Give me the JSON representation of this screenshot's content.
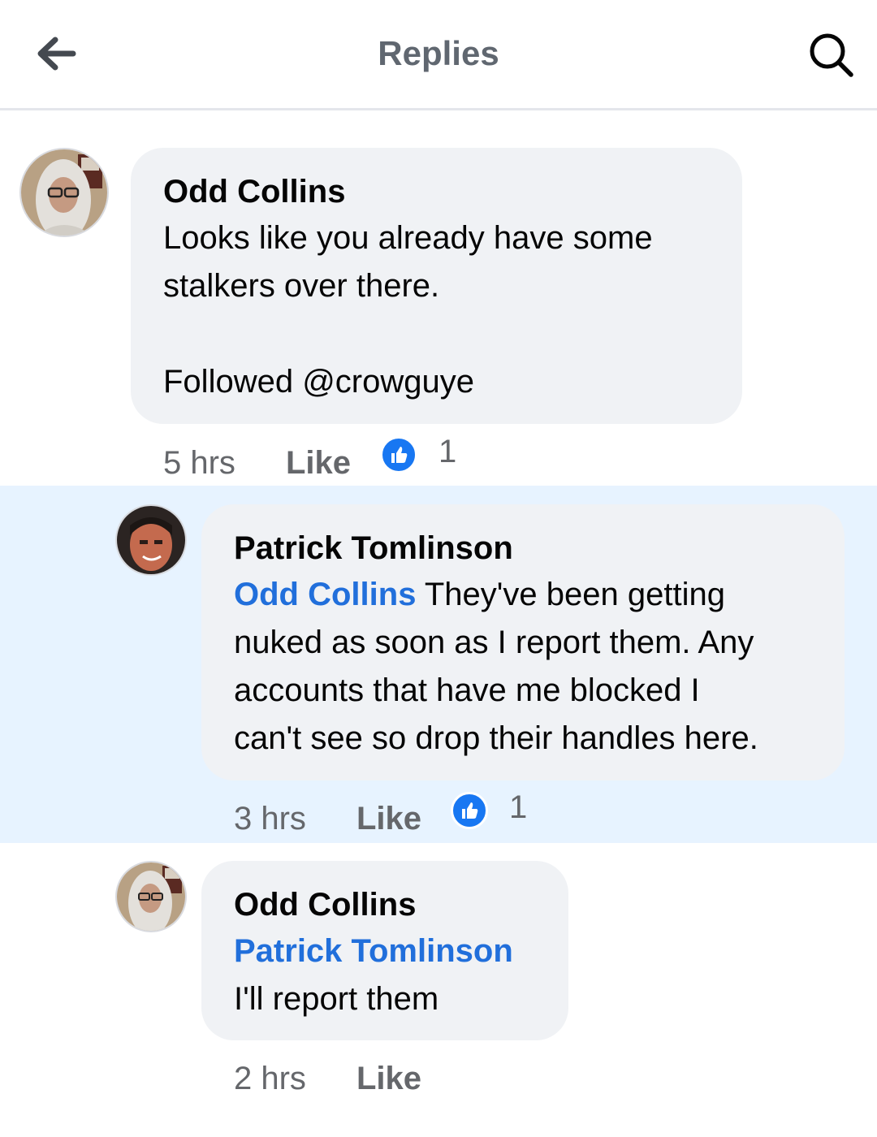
{
  "header": {
    "title": "Replies",
    "back_icon": "arrow-left-icon",
    "search_icon": "search-icon"
  },
  "comments": [
    {
      "author": "Odd Collins",
      "mention": "",
      "text": "Looks like you already have some\nstalkers over there.\n\nFollowed @crowguye",
      "time": "5 hrs",
      "like_label": "Like",
      "reaction_count": "1",
      "highlighted": false
    },
    {
      "author": "Patrick Tomlinson",
      "mention": "Odd Collins",
      "text": " They've been getting\nnuked as soon as I report them. Any\naccounts that have me blocked I\ncan't see so drop their handles here.",
      "time": "3 hrs",
      "like_label": "Like",
      "reaction_count": "1",
      "highlighted": true
    },
    {
      "author": "Odd Collins",
      "mention": "Patrick Tomlinson",
      "text": "I'll report them",
      "time": "2 hrs",
      "like_label": "Like",
      "reaction_count": "",
      "highlighted": false
    }
  ],
  "colors": {
    "mention": "#216fdb",
    "highlight": "#e7f3ff",
    "reaction": "#1877f2"
  }
}
